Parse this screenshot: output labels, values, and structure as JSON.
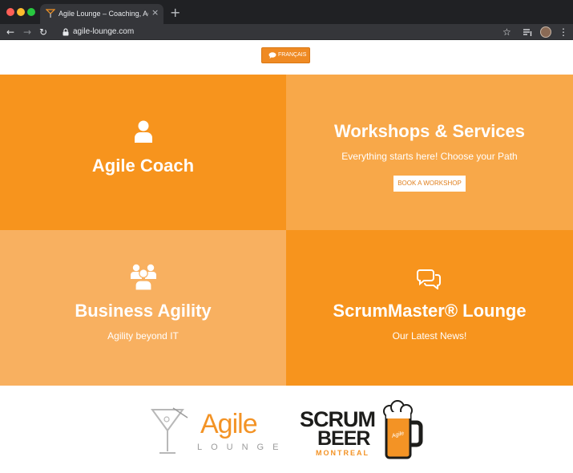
{
  "browser": {
    "tab_title": "Agile Lounge – Coaching, Agile",
    "tab_close": "×",
    "new_tab": "+",
    "url": "agile-lounge.com"
  },
  "header": {
    "language_button": "FRANÇAIS"
  },
  "tiles": [
    {
      "title": "Agile Coach",
      "icon": "user-icon"
    },
    {
      "title": "Workshops & Services",
      "subtitle": "Everything starts here! Choose your Path",
      "button": "BOOK A WORKSHOP"
    },
    {
      "title": "Business Agility",
      "subtitle": "Agility beyond IT",
      "icon": "group-icon"
    },
    {
      "title": "ScrumMaster® Lounge",
      "subtitle": "Our Latest News!",
      "icon": "chat-bubbles-icon"
    }
  ],
  "logos": {
    "agile_lounge": {
      "word": "Agile",
      "sub": "LOUNGE"
    },
    "scrum_beer": {
      "line1": "SCRUM",
      "line2": "BEER",
      "line3": "MONTREAL",
      "mug_text": "Agile"
    }
  },
  "colors": {
    "accent": "#f7941d",
    "tile_light": "#f8a849",
    "tile_lighter": "#f8b060",
    "chrome_dark": "#202124"
  }
}
